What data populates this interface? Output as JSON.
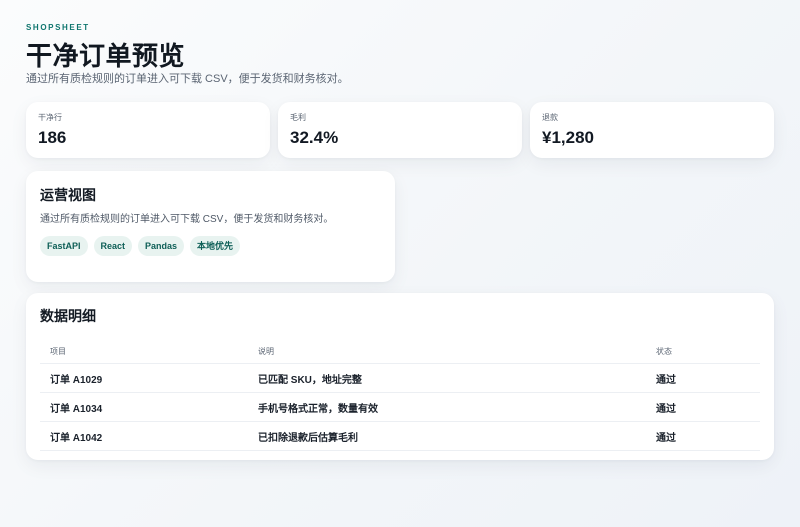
{
  "header": {
    "brand": "SHOPSHEET",
    "title": "干净订单预览",
    "subtitle": "通过所有质检规则的订单进入可下载 CSV，便于发货和财务核对。"
  },
  "stats": [
    {
      "label": "干净行",
      "value": "186"
    },
    {
      "label": "毛利",
      "value": "32.4%"
    },
    {
      "label": "退款",
      "value": "¥1,280"
    }
  ],
  "ops": {
    "title": "运营视图",
    "description": "通过所有质检规则的订单进入可下载 CSV，便于发货和财务核对。",
    "tags": [
      "FastAPI",
      "React",
      "Pandas",
      "本地优先"
    ]
  },
  "details": {
    "title": "数据明细",
    "columns": [
      "项目",
      "说明",
      "状态"
    ],
    "rows": [
      {
        "item": "订单 A1029",
        "note": "已匹配 SKU，地址完整",
        "status": "通过"
      },
      {
        "item": "订单 A1034",
        "note": "手机号格式正常，数量有效",
        "status": "通过"
      },
      {
        "item": "订单 A1042",
        "note": "已扣除退款后估算毛利",
        "status": "通过"
      }
    ]
  },
  "colors": {
    "accent": "#0f766e",
    "tag_bg": "#e8f3f0",
    "tag_text": "#0e5f57"
  }
}
